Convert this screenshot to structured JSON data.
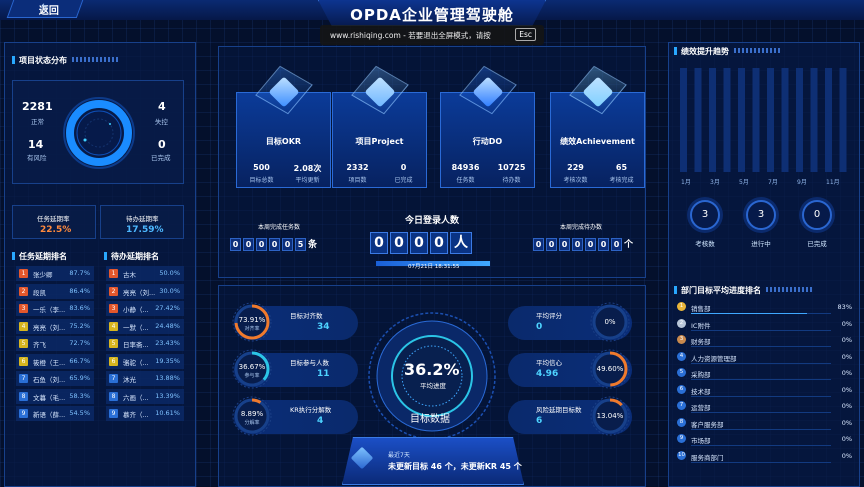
{
  "header": {
    "back_label": "返回",
    "title": "OPDA企业管理驾驶舱",
    "esc_message": "www.rishiqing.com - 若要退出全屏模式，请按",
    "esc_key": "Esc"
  },
  "project_status": {
    "title": "项目状态分布",
    "normal_value": "2281",
    "normal_label": "正常",
    "risk_value": "14",
    "risk_label": "有风险",
    "lost_value": "4",
    "lost_label": "失控",
    "done_value": "0",
    "done_label": "已完成"
  },
  "delay_rates": {
    "task_label": "任务延期率",
    "task_value": "22.5%",
    "todo_label": "待办延期率",
    "todo_value": "17.59%"
  },
  "task_delay_rank": {
    "title": "任务延期排名",
    "rows": [
      {
        "rank": "1",
        "name": "张少卿",
        "value": "87.7%",
        "color": "#e3572c"
      },
      {
        "rank": "2",
        "name": "段凯",
        "value": "86.4%",
        "color": "#e3572c"
      },
      {
        "rank": "3",
        "name": "一乐（李...",
        "value": "83.6%",
        "color": "#e3572c"
      },
      {
        "rank": "4",
        "name": "亮亮（刘...",
        "value": "75.2%",
        "color": "#d6b51f"
      },
      {
        "rank": "5",
        "name": "齐飞",
        "value": "72.7%",
        "color": "#d6b51f"
      },
      {
        "rank": "6",
        "name": "筱橙（王...",
        "value": "66.7%",
        "color": "#d6b51f"
      },
      {
        "rank": "7",
        "name": "石鱼（刘...",
        "value": "65.9%",
        "color": "#2a6fd6"
      },
      {
        "rank": "8",
        "name": "文暮（毛...",
        "value": "58.3%",
        "color": "#2a6fd6"
      },
      {
        "rank": "9",
        "name": "新语（薛...",
        "value": "54.5%",
        "color": "#2a6fd6"
      }
    ]
  },
  "todo_delay_rank": {
    "title": "待办延期排名",
    "rows": [
      {
        "rank": "1",
        "name": "古木",
        "value": "50.0%",
        "color": "#e3572c"
      },
      {
        "rank": "2",
        "name": "亮亮（刘...",
        "value": "30.0%",
        "color": "#e3572c"
      },
      {
        "rank": "3",
        "name": "小静（...",
        "value": "27.42%",
        "color": "#e3572c"
      },
      {
        "rank": "4",
        "name": "一默（...",
        "value": "24.48%",
        "color": "#d6b51f"
      },
      {
        "rank": "5",
        "name": "日率斋...",
        "value": "23.43%",
        "color": "#d6b51f"
      },
      {
        "rank": "6",
        "name": "骆驼（...",
        "value": "19.35%",
        "color": "#d6b51f"
      },
      {
        "rank": "7",
        "name": "沐光",
        "value": "13.88%",
        "color": "#2a6fd6"
      },
      {
        "rank": "8",
        "name": "六画（...",
        "value": "13.39%",
        "color": "#2a6fd6"
      },
      {
        "rank": "9",
        "name": "慕齐（...",
        "value": "10.61%",
        "color": "#2a6fd6"
      }
    ]
  },
  "cards": [
    {
      "name": "目标OKR",
      "v1": "500",
      "l1": "目标总数",
      "v2": "2.08次",
      "l2": "平均更新"
    },
    {
      "name": "项目Project",
      "v1": "2332",
      "l1": "项目数",
      "v2": "0",
      "l2": "已完成"
    },
    {
      "name": "行动DO",
      "v1": "84936",
      "l1": "任务数",
      "v2": "10725",
      "l2": "待办数"
    },
    {
      "name": "绩效Achievement",
      "v1": "229",
      "l1": "考核次数",
      "v2": "65",
      "l2": "考核完成"
    }
  ],
  "counters": {
    "week_task_label": "本周完成任务数",
    "week_task_digits": [
      "0",
      "0",
      "0",
      "0",
      "0",
      "5"
    ],
    "week_task_unit": "条",
    "login_label": "今日登录人数",
    "login_digits": [
      "0",
      "0",
      "0",
      "0"
    ],
    "login_unit": "人",
    "login_date": "07月21日 18:31:55",
    "week_todo_label": "本周完成待办数",
    "week_todo_digits": [
      "0",
      "0",
      "0",
      "0",
      "0",
      "0",
      "0"
    ],
    "week_todo_unit": "个"
  },
  "goal_data": {
    "center_value": "36.2%",
    "center_label": "平均进度",
    "title": "目标数据",
    "left": [
      {
        "pct": "73.91%",
        "sub": "对齐率",
        "label": "目标对齐数",
        "value": "34",
        "frac": 0.7391,
        "color": "#f07a2c"
      },
      {
        "pct": "36.67%",
        "sub": "参与率",
        "label": "目标参与人数",
        "value": "11",
        "frac": 0.3667,
        "color": "#2bc4e6"
      },
      {
        "pct": "8.89%",
        "sub": "分解率",
        "label": "KR执行分解数",
        "value": "4",
        "frac": 0.0889,
        "color": "#f07a2c"
      }
    ],
    "right": [
      {
        "label": "平均评分",
        "value": "0",
        "pct": "0%",
        "frac": 0,
        "color": "#2bc4e6"
      },
      {
        "label": "平均信心",
        "value": "4.96",
        "pct": "49.60%",
        "frac": 0.496,
        "color": "#f07a2c"
      },
      {
        "label": "风险延期目标数",
        "value": "6",
        "pct": "13.04%",
        "frac": 0.1304,
        "color": "#f07a2c"
      }
    ],
    "update_title": "最近7天",
    "update_text": "未更新目标 46 个，未更新KR 45 个"
  },
  "performance": {
    "title": "绩效提升趋势",
    "x_ticks": [
      "1月",
      "3月",
      "5月",
      "7月",
      "9月",
      "11月"
    ],
    "stats": [
      {
        "value": "3",
        "label": "考核数"
      },
      {
        "value": "3",
        "label": "进行中"
      },
      {
        "value": "0",
        "label": "已完成"
      }
    ]
  },
  "dept_rank": {
    "title": "部门目标平均进度排名",
    "rows": [
      {
        "rank": "1",
        "name": "销售部",
        "value": "83%",
        "frac": 0.83
      },
      {
        "rank": "2",
        "name": "IC附件",
        "value": "0%",
        "frac": 0
      },
      {
        "rank": "3",
        "name": "财务部",
        "value": "0%",
        "frac": 0
      },
      {
        "rank": "4",
        "name": "人力资源管理部",
        "value": "0%",
        "frac": 0
      },
      {
        "rank": "5",
        "name": "采购部",
        "value": "0%",
        "frac": 0
      },
      {
        "rank": "6",
        "name": "技术部",
        "value": "0%",
        "frac": 0
      },
      {
        "rank": "7",
        "name": "运营部",
        "value": "0%",
        "frac": 0
      },
      {
        "rank": "8",
        "name": "客户服务部",
        "value": "0%",
        "frac": 0
      },
      {
        "rank": "9",
        "name": "市场部",
        "value": "0%",
        "frac": 0
      },
      {
        "rank": "10",
        "name": "服务商部门",
        "value": "0%",
        "frac": 0
      }
    ]
  }
}
